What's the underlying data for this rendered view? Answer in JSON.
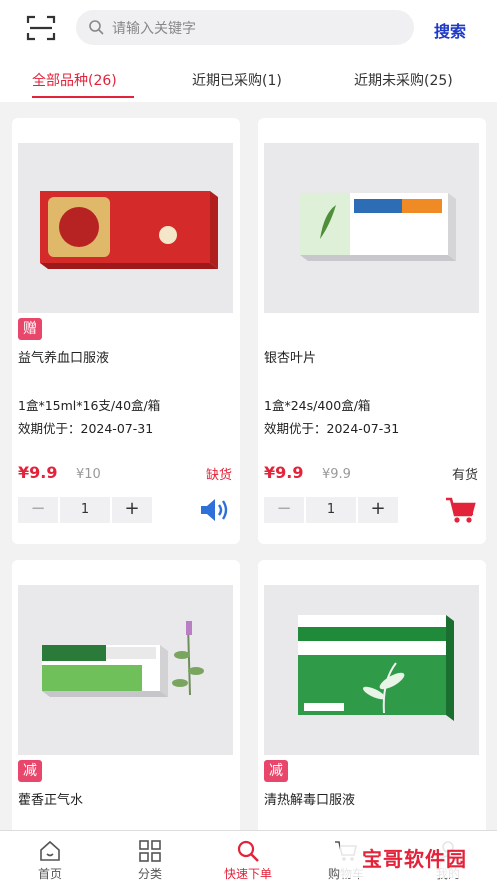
{
  "header": {
    "search_placeholder": "请输入关键字",
    "search_button": "搜索"
  },
  "tabs": [
    {
      "label": "全部品种(26)",
      "active": true
    },
    {
      "label": "近期已采购(1)",
      "active": false
    },
    {
      "label": "近期未采购(25)",
      "active": false
    }
  ],
  "products": [
    {
      "badge": "赠",
      "name": "益气养血口服液",
      "spec": "1盒*15ml*16支/40盒/箱",
      "expiry": "效期优于：2024-07-31",
      "price": "¥9.9",
      "original_price": "¥10",
      "stock": "缺货",
      "stock_color": "#e2233a",
      "quantity": "1",
      "action_icon": "speaker-icon"
    },
    {
      "badge": "",
      "name": "银杏叶片",
      "spec": "1盒*24s/400盒/箱",
      "expiry": "效期优于：2024-07-31",
      "price": "¥9.9",
      "original_price": "¥9.9",
      "stock": "有货",
      "stock_color": "#333333",
      "quantity": "1",
      "action_icon": "cart-icon"
    },
    {
      "badge": "减",
      "name": "藿香正气水"
    },
    {
      "badge": "减",
      "name": "清热解毒口服液"
    }
  ],
  "bottom_nav": [
    {
      "label": "首页",
      "icon": "home-icon"
    },
    {
      "label": "分类",
      "icon": "grid-icon"
    },
    {
      "label": "快速下单",
      "icon": "search-icon",
      "active": true
    },
    {
      "label": "购物车",
      "icon": "cart-icon"
    },
    {
      "label": "我的",
      "icon": "user-icon"
    }
  ],
  "watermark": "宝哥软件园",
  "colors": {
    "accent": "#e2233a",
    "search_link": "#1f3ac7",
    "badge": "#e8476b"
  }
}
